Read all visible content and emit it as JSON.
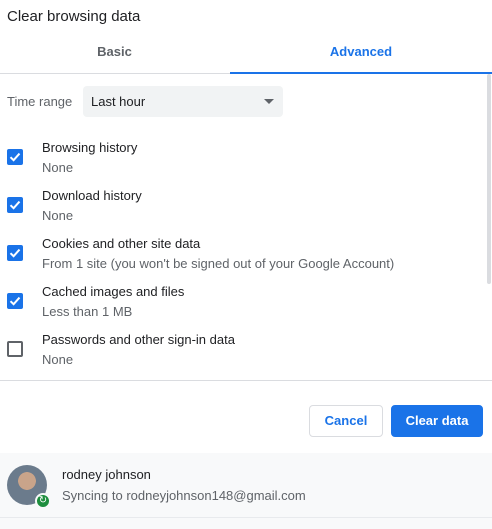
{
  "dialog": {
    "title": "Clear browsing data"
  },
  "tabs": [
    {
      "label": "Basic",
      "selected": false
    },
    {
      "label": "Advanced",
      "selected": true
    }
  ],
  "time_range": {
    "label": "Time range",
    "value": "Last hour"
  },
  "options": [
    {
      "title": "Browsing history",
      "subtitle": "None",
      "checked": true
    },
    {
      "title": "Download history",
      "subtitle": "None",
      "checked": true
    },
    {
      "title": "Cookies and other site data",
      "subtitle": "From 1 site (you won't be signed out of your Google Account)",
      "checked": true
    },
    {
      "title": "Cached images and files",
      "subtitle": "Less than 1 MB",
      "checked": true
    },
    {
      "title": "Passwords and other sign-in data",
      "subtitle": "None",
      "checked": false
    }
  ],
  "buttons": {
    "cancel": "Cancel",
    "clear": "Clear data"
  },
  "account": {
    "name": "rodney johnson",
    "status": "Syncing to rodneyjohnson148@gmail.com"
  },
  "colors": {
    "accent": "#1a73e8",
    "sync_badge": "#1e8e3e"
  }
}
